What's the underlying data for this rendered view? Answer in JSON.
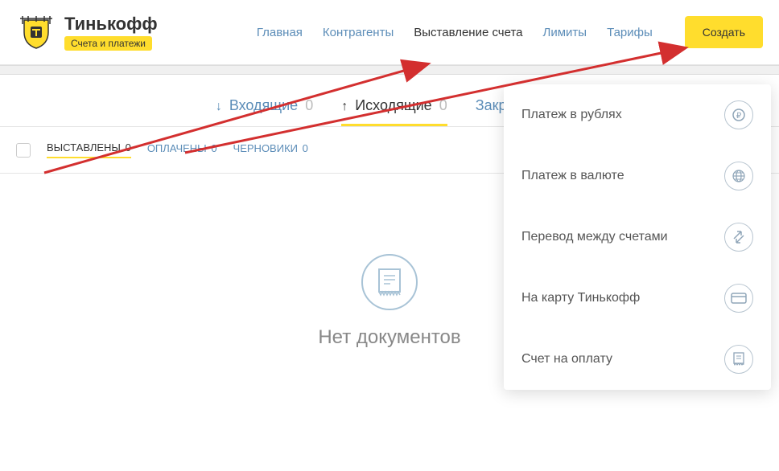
{
  "header": {
    "brand_name": "Тинькофф",
    "brand_sub": "Счета и платежи"
  },
  "nav": {
    "items": [
      {
        "label": "Главная"
      },
      {
        "label": "Контрагенты"
      },
      {
        "label": "Выставление счета"
      },
      {
        "label": "Лимиты"
      },
      {
        "label": "Тарифы"
      }
    ],
    "create_label": "Создать"
  },
  "tabs": {
    "incoming": {
      "label": "Входящие",
      "count": "0"
    },
    "outgoing": {
      "label": "Исходящие",
      "count": "0"
    },
    "closing": {
      "label": "Закрывающи"
    }
  },
  "filters": {
    "issued": {
      "label": "ВЫСТАВЛЕНЫ",
      "count": "0"
    },
    "paid": {
      "label": "ОПЛАЧЕНЫ",
      "count": "0"
    },
    "drafts": {
      "label": "ЧЕРНОВИКИ",
      "count": "0"
    }
  },
  "empty": {
    "text": "Нет документов"
  },
  "dropdown": {
    "items": [
      {
        "label": "Платеж в рублях",
        "icon": "ruble"
      },
      {
        "label": "Платеж в валюте",
        "icon": "globe"
      },
      {
        "label": "Перевод между счетами",
        "icon": "transfer"
      },
      {
        "label": "На карту Тинькофф",
        "icon": "card"
      },
      {
        "label": "Счет на оплату",
        "icon": "invoice"
      }
    ]
  }
}
